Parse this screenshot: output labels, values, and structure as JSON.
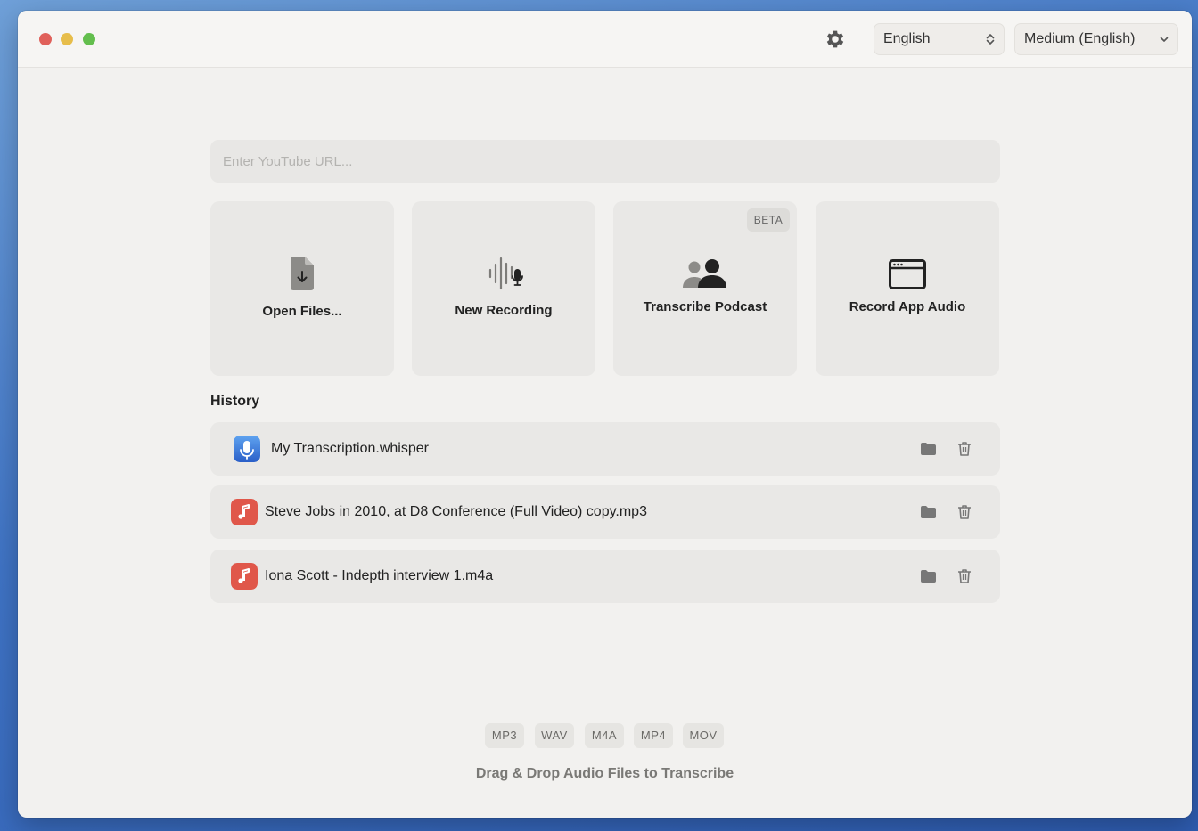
{
  "toolbar": {
    "language_select": "English",
    "model_select": "Medium (English)"
  },
  "url_input": {
    "placeholder": "Enter YouTube URL...",
    "value": ""
  },
  "actions": [
    {
      "label": "Open Files...",
      "icon": "file-download-icon"
    },
    {
      "label": "New Recording",
      "icon": "waveform-mic-icon"
    },
    {
      "label": "Transcribe Podcast",
      "icon": "people-icon",
      "badge": "BETA"
    },
    {
      "label": "Record App Audio",
      "icon": "app-window-icon"
    }
  ],
  "history": {
    "title": "History",
    "items": [
      {
        "name": "My Transcription.whisper",
        "icon": "whisper-app-icon"
      },
      {
        "name": "Steve Jobs in 2010, at D8 Conference (Full Video) copy.mp3",
        "icon": "music-file-icon"
      },
      {
        "name": "Iona Scott - Indepth interview 1.m4a",
        "icon": "music-file-icon"
      }
    ]
  },
  "formats": [
    "MP3",
    "WAV",
    "M4A",
    "MP4",
    "MOV"
  ],
  "drop_text": "Drag & Drop Audio Files to Transcribe",
  "colors": {
    "window_bg": "#f2f1ef",
    "card_bg": "#e9e8e6",
    "music_icon": "#e0574a",
    "whisper_icon": "#3b7be0"
  }
}
